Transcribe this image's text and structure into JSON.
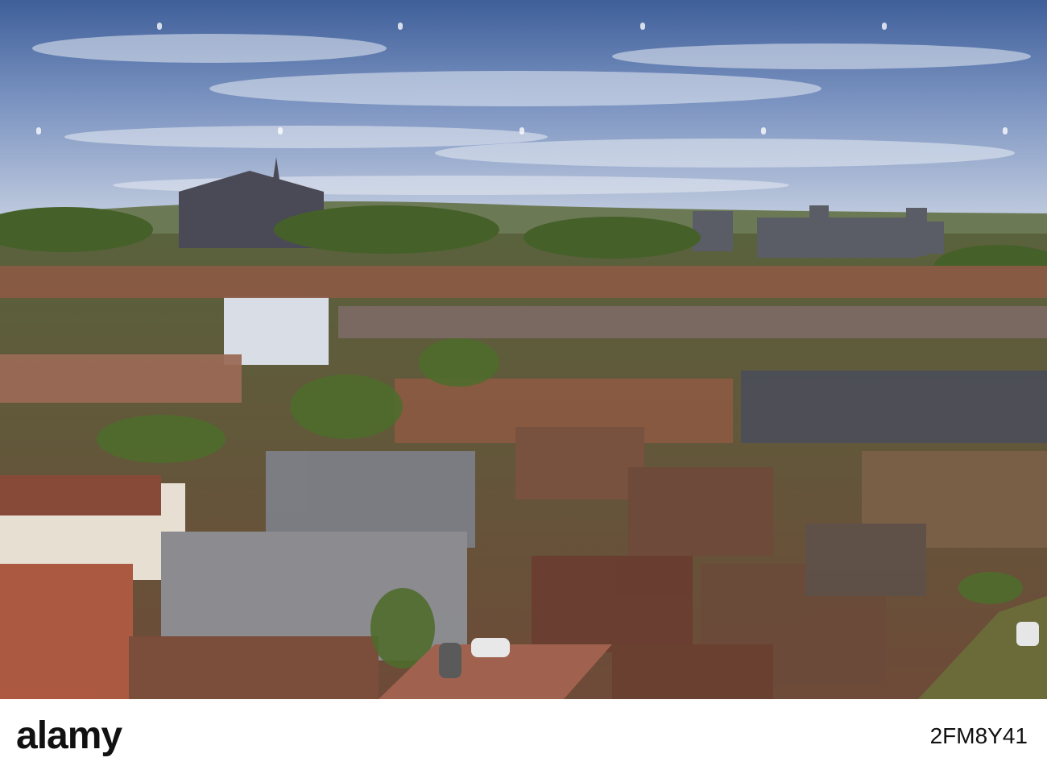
{
  "image": {
    "subject": "aerial-townscape",
    "sky_color": "#5a7ab0",
    "roof_color": "#7a4a3a",
    "foliage_color": "#4f6b2c",
    "river_color": "#6b6b3a"
  },
  "watermark": {
    "brand": "alamy",
    "image_id": "2FM8Y41"
  }
}
